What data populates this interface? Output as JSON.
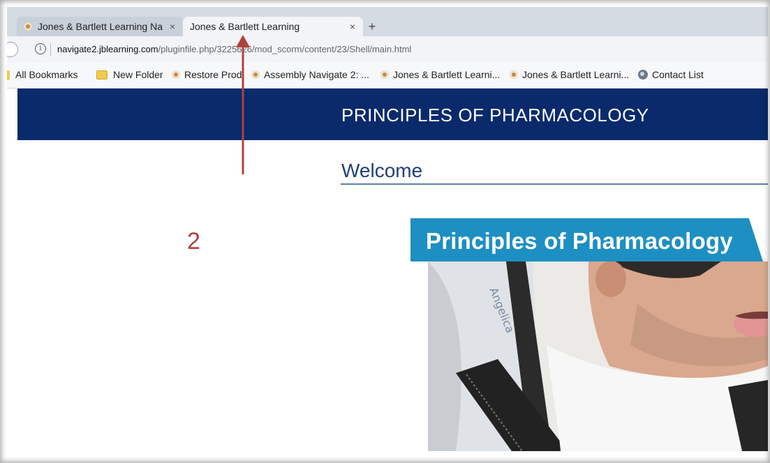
{
  "browser": {
    "tabs": [
      {
        "title": "Jones & Bartlett Learning Na",
        "active": false,
        "close": "×"
      },
      {
        "title": "Jones & Bartlett Learning",
        "active": true,
        "close": "×"
      }
    ],
    "new_tab_label": "+",
    "info_icon": "i",
    "url_host": "navigate2.jblearning.com",
    "url_path": "/pluginfile.php/3225626/mod_scorm/content/23/Shell/main.html",
    "bookmarks": [
      {
        "label": "All Bookmarks",
        "icon": "folder-icon"
      },
      {
        "label": "New Folder",
        "icon": "folder-icon"
      },
      {
        "label": "Restore Prod",
        "icon": "site-favicon-icon"
      },
      {
        "label": "Assembly Navigate 2: ...",
        "icon": "site-favicon-icon"
      },
      {
        "label": "Jones & Bartlett Learni...",
        "icon": "site-favicon-icon"
      },
      {
        "label": "Jones & Bartlett Learni...",
        "icon": "site-favicon-icon"
      },
      {
        "label": "Contact List",
        "icon": "globe-icon"
      }
    ]
  },
  "page": {
    "banner_title": "PRINCIPLES OF PHARMACOLOGY",
    "heading": "Welcome",
    "cover_title": "Principles of Pharmacology",
    "cover_strap_text": "Angelica"
  },
  "annotation": {
    "step_number": "2",
    "color": "#b0413e"
  },
  "colors": {
    "banner": "#0a2a6c",
    "heading": "#1f3f78",
    "cover_band": "#1e8fc3"
  }
}
